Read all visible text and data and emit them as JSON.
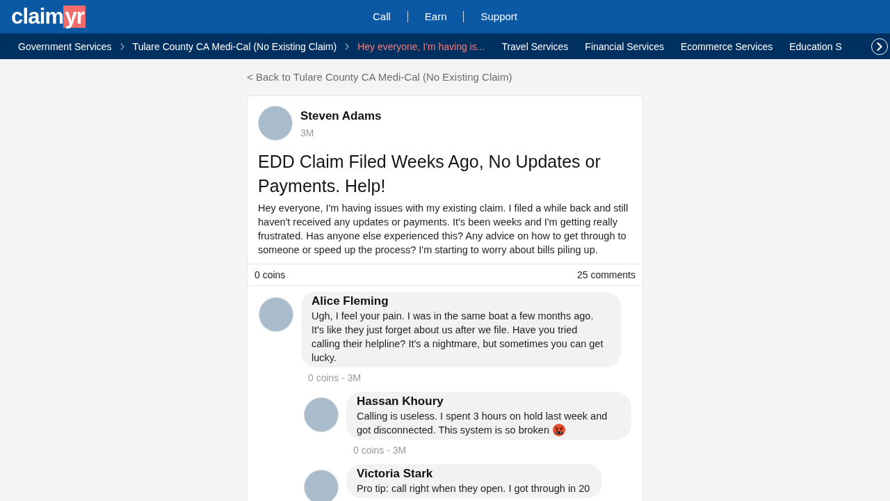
{
  "header": {
    "logo": {
      "text": "claim",
      "highlight": "yr"
    },
    "nav": [
      {
        "label": "Call"
      },
      {
        "label": "Earn"
      },
      {
        "label": "Support"
      }
    ]
  },
  "breadcrumbs": [
    {
      "label": "Government Services",
      "current": false
    },
    {
      "label": "Tulare County CA Medi-Cal (No Existing Claim)",
      "current": false
    },
    {
      "label": "Hey everyone, I'm having is...",
      "current": true
    }
  ],
  "categories": [
    "Travel Services",
    "Financial Services",
    "Ecommerce Services",
    "Education S"
  ],
  "back_link": "< Back to Tulare County CA Medi-Cal (No Existing Claim)",
  "post": {
    "author": "Steven Adams",
    "age": "3M",
    "title": "EDD Claim Filed Weeks Ago, No Updates or Payments. Help!",
    "body": "Hey everyone, I'm having issues with my existing claim. I filed a while back and still haven't received any updates or payments. It's been weeks and I'm getting really frustrated. Has anyone else experienced this? Any advice on how to get through to someone or speed up the process? I'm starting to worry about bills piling up.",
    "coins": "0 coins",
    "comments_count": "25 comments"
  },
  "comments": [
    {
      "author": "Alice Fleming",
      "text": "Ugh, I feel your pain. I was in the same boat a few months ago. It's like they just forget about us after we file. Have you tried calling their helpline? It's a nightmare, but sometimes you can get lucky.",
      "meta": "0 coins - 3M",
      "replies": [
        {
          "author": "Hassan Khoury",
          "text": "Calling is useless. I spent 3 hours on hold last week and got disconnected. This system is so broken",
          "emoji": true,
          "meta": "0 coins - 3M"
        },
        {
          "author": "Victoria Stark",
          "text": "Pro tip: call right when they open. I got through in 20"
        }
      ]
    }
  ]
}
